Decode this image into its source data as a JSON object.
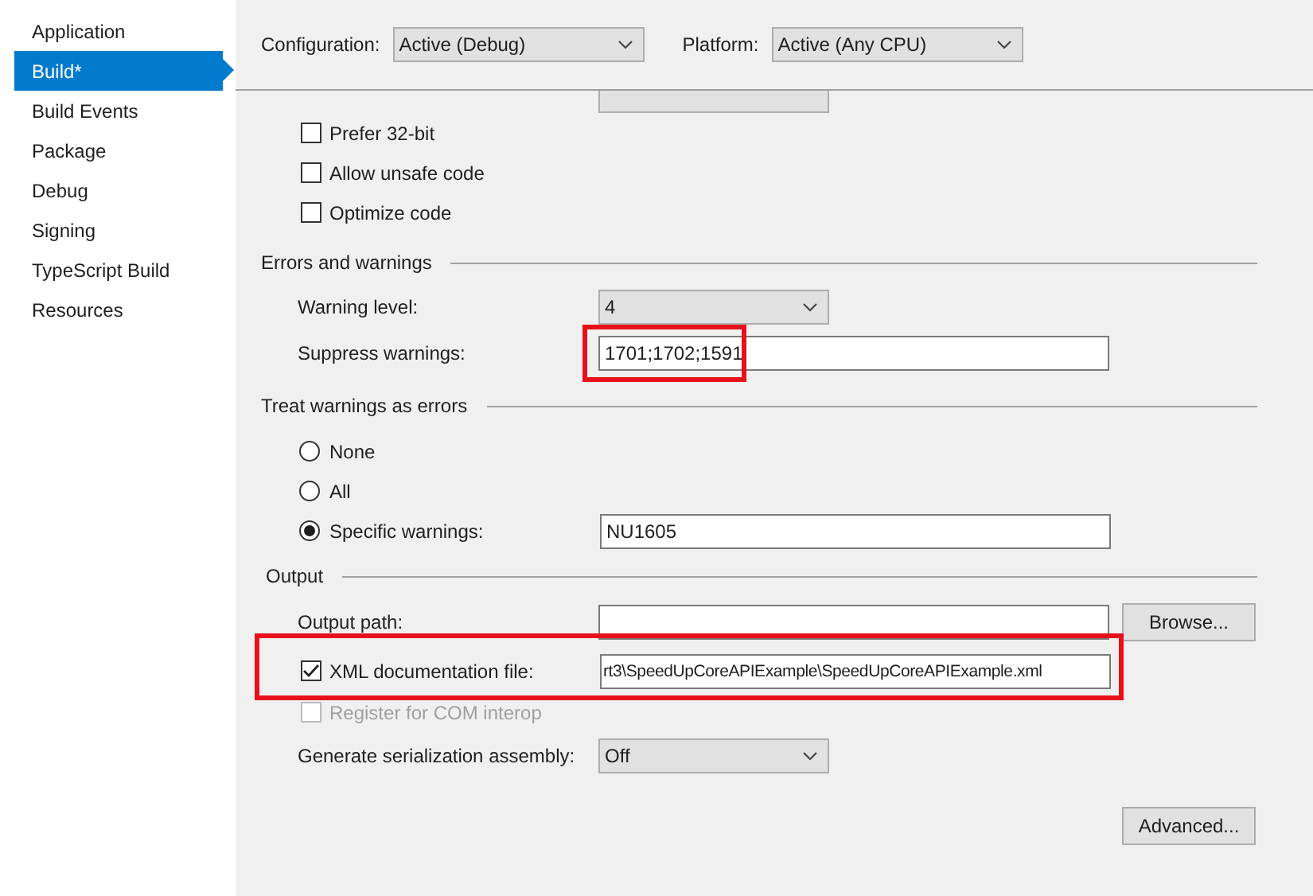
{
  "sidebar": {
    "items": [
      {
        "label": "Application",
        "selected": false
      },
      {
        "label": "Build*",
        "selected": true
      },
      {
        "label": "Build Events",
        "selected": false
      },
      {
        "label": "Package",
        "selected": false
      },
      {
        "label": "Debug",
        "selected": false
      },
      {
        "label": "Signing",
        "selected": false
      },
      {
        "label": "TypeScript Build",
        "selected": false
      },
      {
        "label": "Resources",
        "selected": false
      }
    ]
  },
  "toolbar": {
    "configuration": {
      "label": "Configuration:",
      "value": "Active (Debug)"
    },
    "platform": {
      "label": "Platform:",
      "value": "Active (Any CPU)"
    }
  },
  "general": {
    "checkboxes": [
      {
        "label": "Prefer 32-bit",
        "checked": false
      },
      {
        "label": "Allow unsafe code",
        "checked": false
      },
      {
        "label": "Optimize code",
        "checked": false
      }
    ]
  },
  "errors_and_warnings": {
    "title": "Errors and warnings",
    "warning_level": {
      "label": "Warning level:",
      "value": "4"
    },
    "suppress_warnings": {
      "label": "Suppress warnings:",
      "value": "1701;1702;1591",
      "highlighted": true
    }
  },
  "treat_warnings_as_errors": {
    "title": "Treat warnings as errors",
    "options": [
      {
        "label": "None",
        "selected": false
      },
      {
        "label": "All",
        "selected": false
      },
      {
        "label": "Specific warnings:",
        "selected": true
      }
    ],
    "specific_warnings_value": "NU1605"
  },
  "output": {
    "title": "Output",
    "output_path": {
      "label": "Output path:",
      "button": "Browse..."
    },
    "xml_documentation": {
      "label": "XML documentation file:",
      "checked": true,
      "value": "rt3\\SpeedUpCoreAPIExample\\SpeedUpCoreAPIExample.xml",
      "highlighted": true
    },
    "register_com": {
      "label": "Register for COM interop",
      "checked": false,
      "disabled": true
    },
    "serialization": {
      "label": "Generate serialization assembly:",
      "value": "Off"
    }
  },
  "advanced_button": "Advanced..."
}
